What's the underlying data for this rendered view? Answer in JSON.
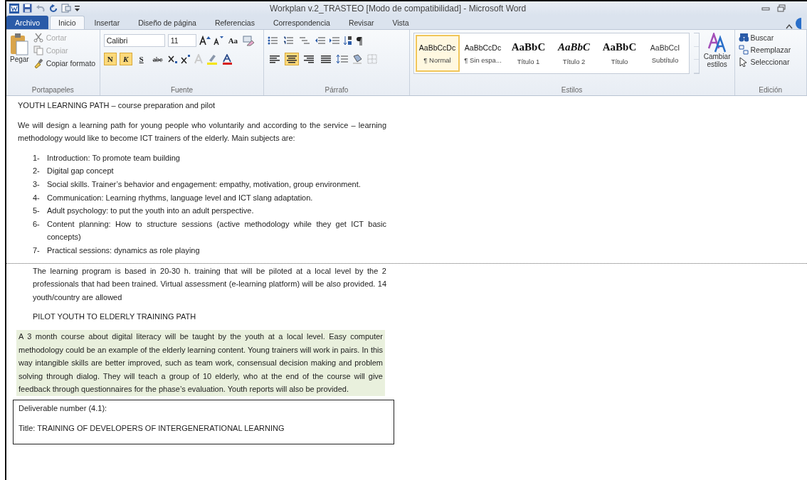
{
  "title_bar": {
    "title": "Workplan v.2_TRASTEO [Modo de compatibilidad] - Microsoft Word"
  },
  "ribbon_tabs": [
    {
      "label": "Archivo",
      "kind": "file",
      "selected": false
    },
    {
      "label": "Inicio",
      "kind": "tab",
      "selected": true
    },
    {
      "label": "Insertar",
      "kind": "tab",
      "selected": false
    },
    {
      "label": "Diseño de página",
      "kind": "tab",
      "selected": false
    },
    {
      "label": "Referencias",
      "kind": "tab",
      "selected": false
    },
    {
      "label": "Correspondencia",
      "kind": "tab",
      "selected": false
    },
    {
      "label": "Revisar",
      "kind": "tab",
      "selected": false
    },
    {
      "label": "Vista",
      "kind": "tab",
      "selected": false
    }
  ],
  "clipboard": {
    "label": "Portapapeles",
    "paste": "Pegar",
    "actions": [
      {
        "label": "Cortar",
        "kind": "cut",
        "disabled": true
      },
      {
        "label": "Copiar",
        "kind": "copy",
        "disabled": true
      },
      {
        "label": "Copiar formato",
        "kind": "brush",
        "disabled": false
      }
    ]
  },
  "font": {
    "label": "Fuente",
    "font_name": "Calibri",
    "font_size": "11",
    "case_button": "Aa",
    "format_buttons": [
      {
        "label": "N",
        "kind": "bold",
        "selected": true
      },
      {
        "label": "K",
        "kind": "italic",
        "selected": true
      },
      {
        "label": "S",
        "kind": "underline",
        "selected": false
      },
      {
        "label": "abc",
        "kind": "strike",
        "selected": false
      }
    ]
  },
  "paragraph": {
    "label": "Párrafo",
    "alignment": [
      {
        "kind": "left",
        "selected": false
      },
      {
        "kind": "center",
        "selected": true
      },
      {
        "kind": "right",
        "selected": false
      },
      {
        "kind": "justify",
        "selected": false
      }
    ]
  },
  "styles": {
    "label": "Estilos",
    "items": [
      {
        "sample": "AaBbCcDc",
        "name": "¶ Normal",
        "kind": "normal",
        "selected": true
      },
      {
        "sample": "AaBbCcDc",
        "name": "¶ Sin espa...",
        "kind": "normal",
        "selected": false
      },
      {
        "sample": "AaBbC",
        "name": "Título 1",
        "kind": "heading1",
        "selected": false
      },
      {
        "sample": "AaBbC",
        "name": "Título 2",
        "kind": "heading2",
        "selected": false
      },
      {
        "sample": "AaBbC",
        "name": "Título",
        "kind": "heading1",
        "selected": false
      },
      {
        "sample": "AaBbCcI",
        "name": "Subtítulo",
        "kind": "subtitle",
        "selected": false
      }
    ],
    "change_button": "Cambiar estilos"
  },
  "editing": {
    "label": "Edición",
    "actions": [
      {
        "label": "Buscar",
        "kind": "find"
      },
      {
        "label": "Reemplazar",
        "kind": "replace"
      },
      {
        "label": "Seleccionar",
        "kind": "select"
      }
    ]
  },
  "document": {
    "blocks": [
      {
        "kind": "paragraph",
        "text": "YOUTH LEARNING PATH – course preparation and pilot"
      },
      {
        "kind": "paragraph",
        "text": "We will design a learning path for young people who voluntarily and according to the service – learning methodology would like to become ICT trainers of the elderly. Main subjects are:"
      },
      {
        "kind": "list",
        "items": [
          {
            "number": "1-",
            "text": "Introduction: To promote team building"
          },
          {
            "number": "2-",
            "text": "Digital gap concept"
          },
          {
            "number": "3-",
            "text": "Social skills. Trainer’s behavior and engagement: empathy, motivation, group environment."
          },
          {
            "number": "4-",
            "text": "Communication: Learning rhythms, language level and ICT slang adaptation."
          },
          {
            "number": "5-",
            "text": "Adult psychology: to put the youth into an adult perspective."
          },
          {
            "number": "6-",
            "text": "Content planning: How to structure sessions (active methodology while they get ICT basic concepts)"
          },
          {
            "number": "7-",
            "text": "Practical sessions: dynamics as role playing"
          }
        ]
      },
      {
        "kind": "break"
      },
      {
        "kind": "indented",
        "text": "The learning program is based in 20-30 h. training that will be piloted at a local level by the 2 professionals that had been trained. Virtual assessment (e-learning platform) will be also provided. 14 youth/country are allowed"
      },
      {
        "kind": "indented",
        "text": "PILOT YOUTH TO ELDERLY TRAINING PATH"
      },
      {
        "kind": "shaded",
        "text": "A 3 month course about digital literacy will be taught by the youth at a local level. Easy computer methodology could be an example of the elderly learning content. Young trainers will work in pairs. In this way intangible skills are better improved, such as team work, consensual decision making and problem solving through dialog. They will teach a group of 10 elderly, who at the end of the course will give feedback through questionnaires for the phase’s evaluation. Youth reports will also be provided."
      },
      {
        "kind": "box",
        "lines": [
          "Deliverable number (4.1):",
          "Title: TRAINING OF DEVELOPERS OF INTERGENERATIONAL LEARNING"
        ]
      }
    ]
  }
}
